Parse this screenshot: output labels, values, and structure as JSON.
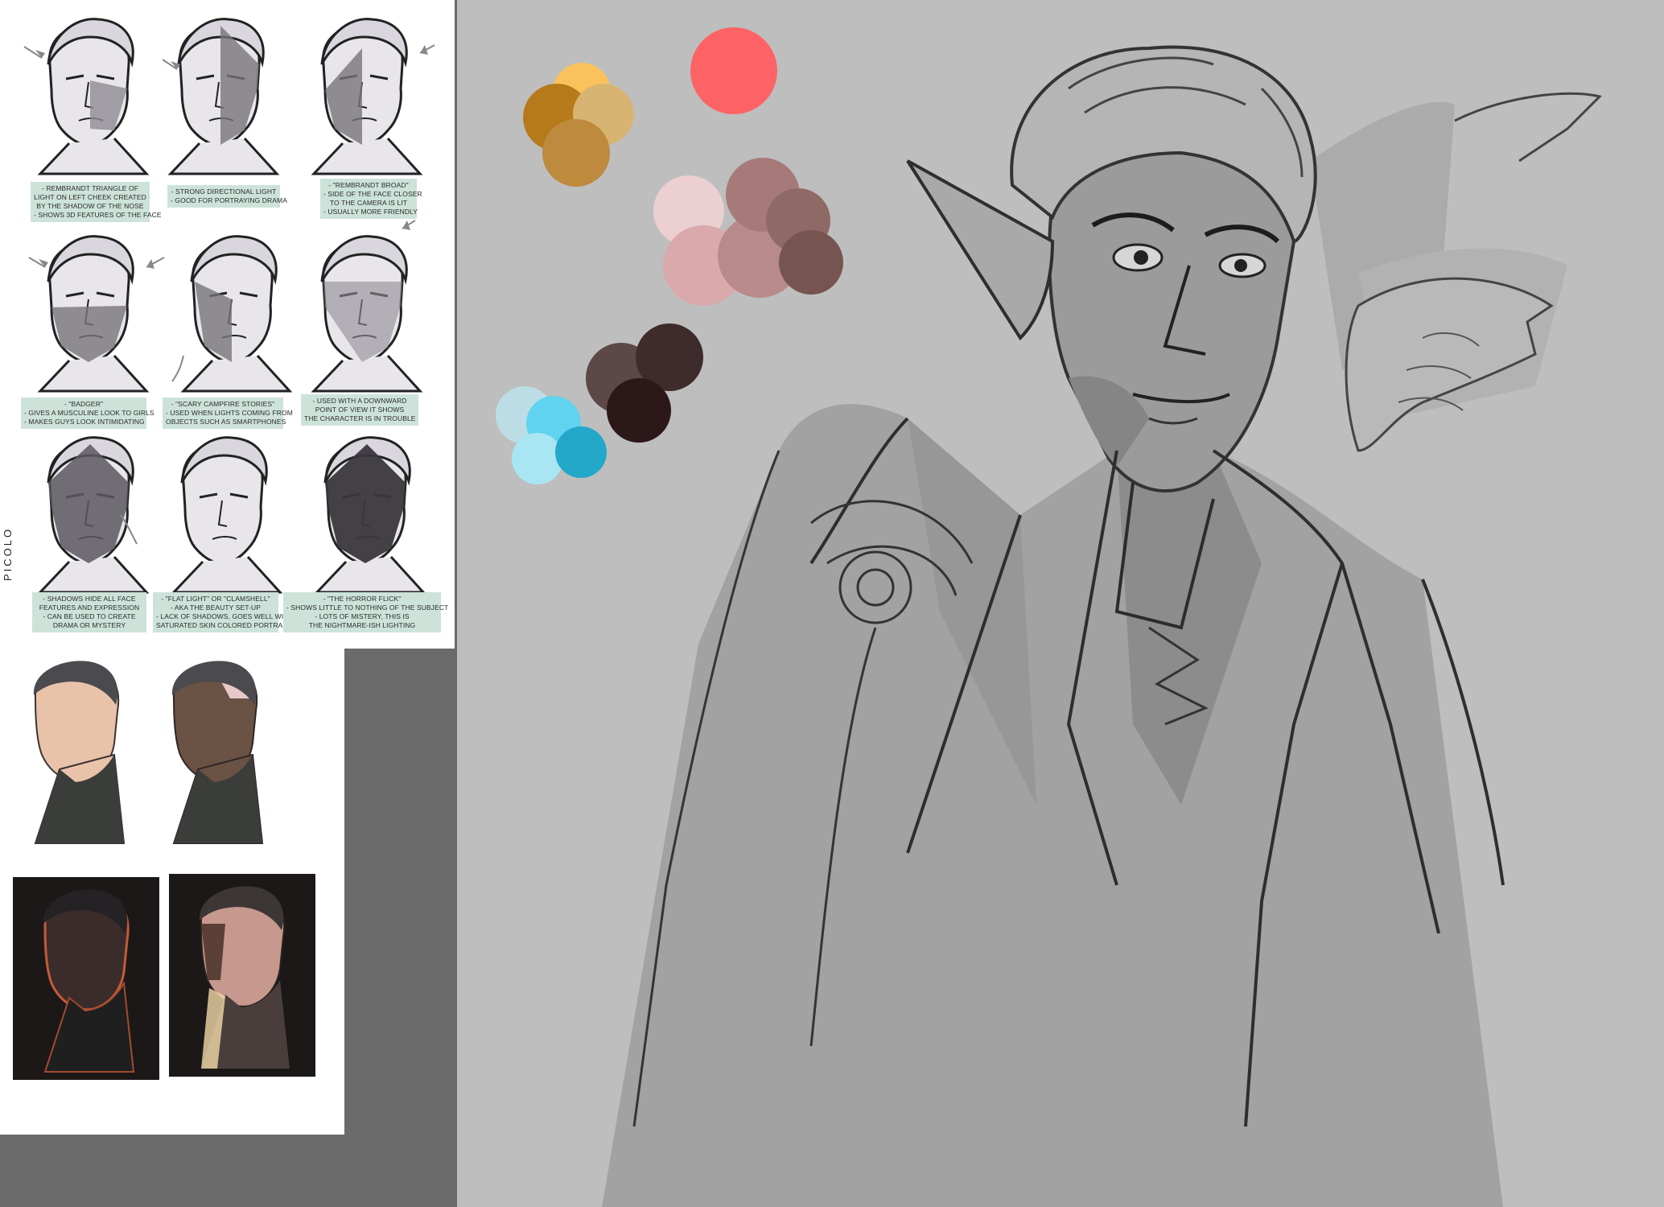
{
  "reference_sheet": {
    "signature": "PICOLO",
    "captions": [
      {
        "id": "rembrandt-triangle",
        "lines": [
          "- Rembrandt triangle of",
          "light on left cheek created",
          "by the shadow of the nose",
          "- shows 3D features of the face"
        ]
      },
      {
        "id": "directional-light",
        "lines": [
          "- strong directional light",
          "- good for portraying drama"
        ]
      },
      {
        "id": "rembrandt-broad",
        "lines": [
          "- \"Rembrandt broad\"",
          "- side of the face closer",
          "to the camera is lit",
          "- usually more friendly"
        ]
      },
      {
        "id": "badger",
        "lines": [
          "- \"Badger\"",
          "- gives a musculine look to girls",
          "- makes guys look intimidating"
        ]
      },
      {
        "id": "scary-campfire",
        "lines": [
          "- \"scary campfire stories\"",
          "- used when lights coming from",
          "objects such as smartphones"
        ]
      },
      {
        "id": "downward-pov",
        "lines": [
          "- used with a downward",
          "point of view it shows",
          "the character is in trouble"
        ]
      },
      {
        "id": "shadows-hide",
        "lines": [
          "- shadows hide all face",
          "features and expression",
          "- can be used to create",
          "drama or mystery"
        ]
      },
      {
        "id": "flat-light",
        "lines": [
          "- \"flat light\" or \"clamshell\"",
          "- aka the beauty set-up",
          "- lack of shadows, goes well with",
          "saturated skin colored portraits"
        ]
      },
      {
        "id": "horror-flick",
        "lines": [
          "- \"The horror flick\"",
          "- shows little to nothing of the subject",
          "- lots of mistery, this is",
          "the nightmare-ish lighting"
        ]
      }
    ]
  },
  "palette": {
    "swatches": [
      {
        "name": "warm-yellow",
        "color": "#f9c25c"
      },
      {
        "name": "amber",
        "color": "#b77a1a"
      },
      {
        "name": "sand",
        "color": "#d8b472"
      },
      {
        "name": "ochre",
        "color": "#be8a3e"
      },
      {
        "name": "coral-red",
        "color": "#fd6365"
      },
      {
        "name": "pale-pink",
        "color": "#ebcfd1"
      },
      {
        "name": "dusty-rose",
        "color": "#d9a9ab"
      },
      {
        "name": "mauve",
        "color": "#b88a8a"
      },
      {
        "name": "rosewood",
        "color": "#a67a79"
      },
      {
        "name": "brown-mauve",
        "color": "#8f6965"
      },
      {
        "name": "cocoa",
        "color": "#765550"
      },
      {
        "name": "dark-taupe",
        "color": "#5d4848"
      },
      {
        "name": "espresso",
        "color": "#3e2b2b"
      },
      {
        "name": "near-black-maroon",
        "color": "#2c1719"
      },
      {
        "name": "powder-blue",
        "color": "#bcdde5"
      },
      {
        "name": "sky-cyan",
        "color": "#5fd3ef"
      },
      {
        "name": "ice-blue",
        "color": "#a8e6f3"
      },
      {
        "name": "teal-blue",
        "color": "#23a8c9"
      }
    ]
  }
}
